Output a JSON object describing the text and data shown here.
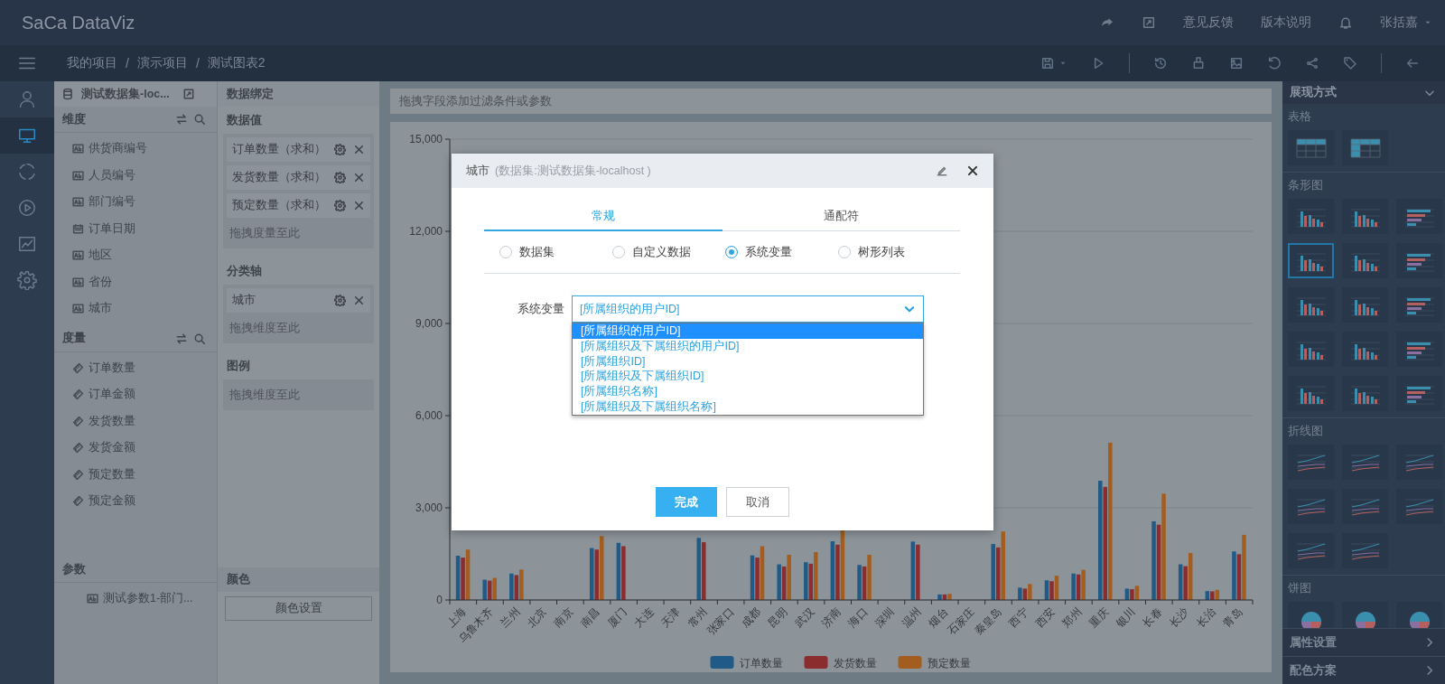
{
  "header": {
    "logo": "SaCa DataViz",
    "links": [
      "意见反馈",
      "版本说明"
    ],
    "user": "张括嘉"
  },
  "breadcrumb": {
    "items": [
      "我的项目",
      "演示项目",
      "测试图表2"
    ],
    "separators": [
      "/",
      "/"
    ]
  },
  "rail": [
    {
      "selected": false
    },
    {
      "selected": true
    },
    {
      "selected": false
    },
    {
      "selected": false
    },
    {
      "selected": false
    },
    {
      "selected": false
    }
  ],
  "fields_panel": {
    "dataset": "测试数据集-loc...",
    "dimensions": {
      "title": "维度",
      "items": [
        {
          "label": "供货商编号",
          "kind": "text"
        },
        {
          "label": "人员编号",
          "kind": "text"
        },
        {
          "label": "部门编号",
          "kind": "text"
        },
        {
          "label": "订单日期",
          "kind": "date"
        },
        {
          "label": "地区",
          "kind": "text"
        },
        {
          "label": "省份",
          "kind": "text"
        },
        {
          "label": "城市",
          "kind": "text"
        }
      ]
    },
    "measures": {
      "title": "度量",
      "items": [
        "订单数量",
        "订单金额",
        "发货数量",
        "发货金额",
        "预定数量",
        "预定金额"
      ]
    },
    "params": {
      "title": "参数",
      "items": [
        {
          "label": "测试参数1-部门...",
          "kind": "text"
        }
      ]
    }
  },
  "binding_panel": {
    "title": "数据绑定",
    "sections": [
      {
        "title": "数据值",
        "chips": [
          "订单数量（求和）",
          "发货数量（求和）",
          "预定数量（求和）"
        ],
        "hint": "拖拽度量至此"
      },
      {
        "title": "分类轴",
        "chips": [
          "城市"
        ],
        "hint": "拖拽维度至此"
      },
      {
        "title": "图例",
        "hint": "拖拽维度至此"
      }
    ],
    "color": {
      "title": "颜色",
      "button": "颜色设置"
    }
  },
  "filter_bar": {
    "hint": "拖拽字段添加过滤条件或参数"
  },
  "chart": {
    "chart_data": {
      "type": "bar",
      "categories": [
        "上海",
        "乌鲁木齐",
        "兰州",
        "北京",
        "南京",
        "南昌",
        "厦门",
        "大连",
        "天津",
        "常州",
        "张家口",
        "成都",
        "昆明",
        "武汉",
        "济南",
        "海口",
        "深圳",
        "温州",
        "烟台",
        "石家庄",
        "秦皇岛",
        "西宁",
        "西安",
        "郑州",
        "重庆",
        "银川",
        "长春",
        "长沙",
        "长治",
        "青岛"
      ],
      "series": [
        {
          "name": "订单数量",
          "color": "#1f5b86",
          "values": [
            1440,
            660,
            860,
            null,
            null,
            1690,
            1860,
            null,
            null,
            2020,
            null,
            1450,
            1160,
            1230,
            1910,
            1140,
            null,
            1900,
            180,
            null,
            1820,
            400,
            640,
            860,
            3880,
            370,
            2560,
            1160,
            290,
            1580
          ]
        },
        {
          "name": "发货数量",
          "color": "#8b2c2e",
          "values": [
            1380,
            630,
            810,
            null,
            null,
            1640,
            1750,
            null,
            null,
            1880,
            null,
            1380,
            1090,
            1180,
            1800,
            1090,
            null,
            1800,
            180,
            null,
            1710,
            370,
            610,
            830,
            3680,
            350,
            2450,
            1100,
            280,
            1490
          ]
        },
        {
          "name": "预定数量",
          "color": "#a35e1f",
          "values": [
            1640,
            720,
            990,
            null,
            null,
            2080,
            null,
            null,
            null,
            null,
            null,
            1750,
            1470,
            1560,
            2260,
            1470,
            null,
            null,
            200,
            null,
            2230,
            520,
            790,
            980,
            5120,
            460,
            3460,
            1530,
            330,
            2120
          ]
        }
      ],
      "grid": true,
      "legend": "bottom",
      "ylim": [
        0,
        15000
      ],
      "yticks": [
        0,
        {
          "value": 3000,
          "label": "3,000"
        },
        {
          "value": 6000,
          "label": "6,000"
        },
        {
          "value": 9000,
          "label": "9,000"
        },
        {
          "value": 12000,
          "label": "12,000"
        },
        {
          "value": 15000,
          "label": "15,000"
        }
      ]
    }
  },
  "right_panel": {
    "title": "展现方式",
    "sections": [
      {
        "title": "表格",
        "kind": "table",
        "items": [
          {
            "selected": false
          },
          {
            "selected": false
          }
        ]
      },
      {
        "title": "条形图",
        "kind": "bar",
        "items": [
          {
            "selected": false
          },
          {
            "selected": false
          },
          {
            "selected": false
          },
          {
            "selected": true
          },
          {
            "selected": false
          },
          {
            "selected": false
          },
          {
            "selected": false
          },
          {
            "selected": false
          },
          {
            "selected": false
          },
          {
            "selected": false
          },
          {
            "selected": false
          },
          {
            "selected": false
          },
          {
            "selected": false
          },
          {
            "selected": false
          },
          {
            "selected": false
          }
        ]
      },
      {
        "title": "折线图",
        "kind": "line",
        "items": [
          {
            "selected": false
          },
          {
            "selected": false
          },
          {
            "selected": false
          },
          {
            "selected": false
          },
          {
            "selected": false
          },
          {
            "selected": false
          },
          {
            "selected": false
          },
          {
            "selected": false
          }
        ]
      },
      {
        "title": "饼图",
        "kind": "pie",
        "items": [
          {
            "selected": false
          },
          {
            "selected": false
          },
          {
            "selected": false
          }
        ]
      }
    ],
    "footer": [
      "属性设置",
      "配色方案"
    ]
  },
  "dialog": {
    "title": "城市",
    "subtitle": "(数据集:测试数据集-localhost )",
    "tabs": [
      {
        "label": "常规",
        "selected": true
      },
      {
        "label": "通配符",
        "selected": false
      }
    ],
    "source_options": [
      {
        "label": "数据集",
        "selected": false
      },
      {
        "label": "自定义数据",
        "selected": false
      },
      {
        "label": "系统变量",
        "selected": true
      },
      {
        "label": "树形列表",
        "selected": false
      }
    ],
    "field": {
      "label": "系统变量",
      "value": "[所属组织的用户ID]",
      "expanded": true,
      "options": [
        {
          "label": "[所属组织的用户ID]",
          "selected": true
        },
        {
          "label": "[所属组织及下属组织的用户ID]",
          "selected": false
        },
        {
          "label": "[所属组织ID]",
          "selected": false
        },
        {
          "label": "[所属组织及下属组织ID]",
          "selected": false
        },
        {
          "label": "[所属组织名称]",
          "selected": false
        },
        {
          "label": "[所属组织及下属组织名称]",
          "selected": false
        }
      ]
    },
    "buttons": [
      {
        "label": "完成",
        "kind": "primary"
      },
      {
        "label": "取消",
        "kind": "default"
      }
    ]
  }
}
